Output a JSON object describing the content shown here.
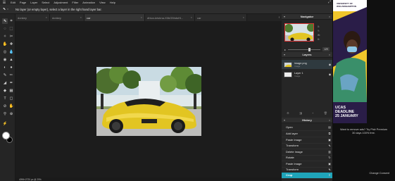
{
  "menu": {
    "items": [
      "Edit",
      "Page",
      "Layer",
      "Select",
      "Adjustment",
      "Filter",
      "Animation",
      "View",
      "Help"
    ]
  },
  "options": {
    "message": "No layer (or empty layer), select a layer in the right hand layer bar."
  },
  "tabs": [
    {
      "label": "donkey",
      "active": false
    },
    {
      "label": "donkey",
      "active": false
    },
    {
      "label": "car",
      "active": true
    },
    {
      "label": "dhiva-krishna-X0bG5hdsHl...",
      "active": false
    },
    {
      "label": "car",
      "active": false
    }
  ],
  "navigator": {
    "title": "Navigator",
    "x": "X:",
    "y": "Y:",
    "w": "W:",
    "h": "H:",
    "zoom": "129"
  },
  "layers": {
    "title": "Layers",
    "items": [
      {
        "name": "image.png",
        "type": "Image",
        "thumb": "car"
      },
      {
        "name": "Layer 1",
        "type": "Image",
        "thumb": "blank"
      }
    ]
  },
  "history": {
    "title": "History",
    "items": [
      {
        "label": "Open",
        "icon": "file-icon",
        "active": false
      },
      {
        "label": "Add layer",
        "icon": "add-layer-icon",
        "active": false
      },
      {
        "label": "Paste Image",
        "icon": "image-icon",
        "active": false
      },
      {
        "label": "Transform",
        "icon": "transform-icon",
        "active": false
      },
      {
        "label": "Delete Image",
        "icon": "trash-icon",
        "active": false
      },
      {
        "label": "Rotate",
        "icon": "rotate-icon",
        "active": false
      },
      {
        "label": "Paste Image",
        "icon": "image-icon",
        "active": false
      },
      {
        "label": "Transform",
        "icon": "transform-icon",
        "active": false
      },
      {
        "label": "Crop",
        "icon": "crop-icon",
        "active": true
      }
    ]
  },
  "status": {
    "text": "4096×2720 px @ 29%"
  },
  "ad": {
    "logo_line1": "UNIVERSITY OF",
    "logo_line2": "WOLVERHAMPTON",
    "line1": "UCAS",
    "line2": "DEADLINE",
    "line3": "25 JANUARY"
  },
  "upsell": {
    "line1": "Want to remove ads? Try Pixlr Premium",
    "line2": "30 days 100% free."
  },
  "consent": "Change Consent"
}
